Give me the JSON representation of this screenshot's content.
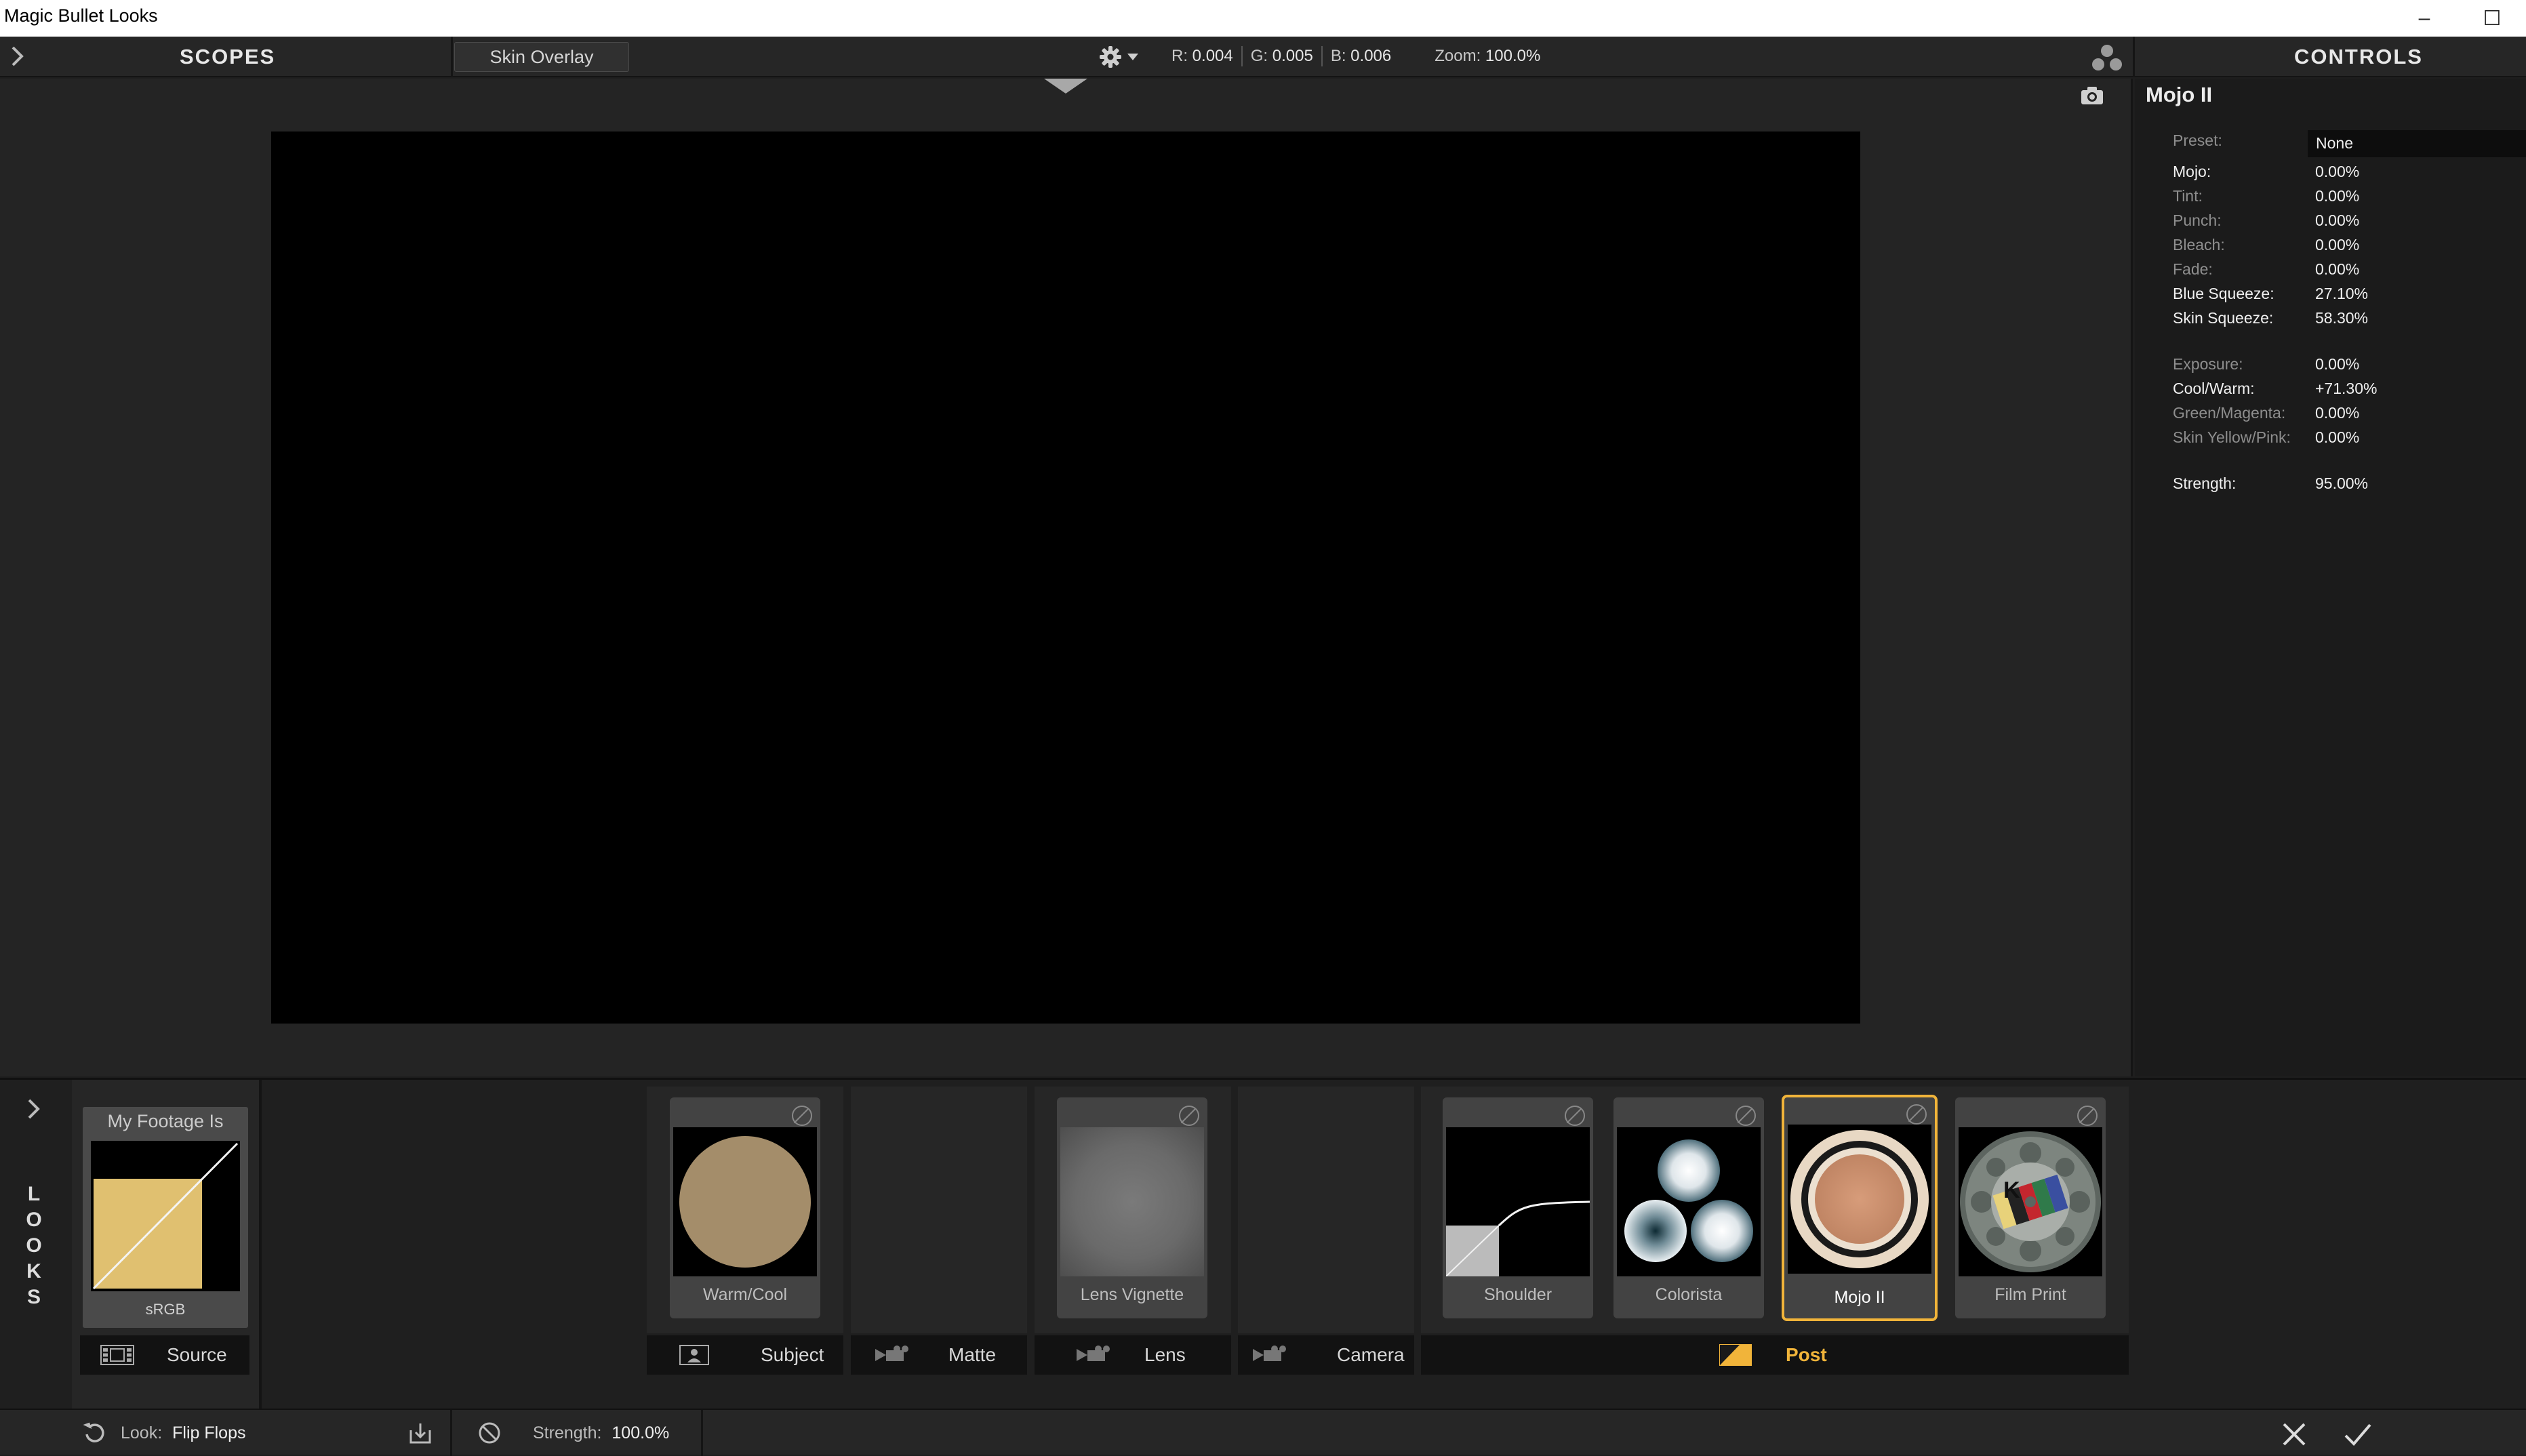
{
  "window": {
    "title": "Magic Bullet Looks",
    "minimize": "–",
    "maximize": "☐"
  },
  "topbar": {
    "scopes_label": "SCOPES",
    "skin_overlay_label": "Skin Overlay",
    "r_label": "R:",
    "r_value": "0.004",
    "g_label": "G:",
    "g_value": "0.005",
    "b_label": "B:",
    "b_value": "0.006",
    "zoom_label": "Zoom:",
    "zoom_value": "100.0%",
    "controls_label": "CONTROLS"
  },
  "controls": {
    "tool_name": "Mojo II",
    "preset_label": "Preset:",
    "preset_value": "None",
    "params": [
      {
        "label": "Mojo:",
        "value": "0.00%"
      },
      {
        "label": "Tint:",
        "value": "0.00%"
      },
      {
        "label": "Punch:",
        "value": "0.00%"
      },
      {
        "label": "Bleach:",
        "value": "0.00%"
      },
      {
        "label": "Fade:",
        "value": "0.00%"
      },
      {
        "label": "Blue Squeeze:",
        "value": "27.10%"
      },
      {
        "label": "Skin Squeeze:",
        "value": "58.30%"
      },
      {
        "label": "Exposure:",
        "value": "0.00%"
      },
      {
        "label": "Cool/Warm:",
        "value": "+71.30%"
      },
      {
        "label": "Green/Magenta:",
        "value": "0.00%"
      },
      {
        "label": "Skin Yellow/Pink:",
        "value": "0.00%"
      },
      {
        "label": "Strength:",
        "value": "95.00%"
      }
    ]
  },
  "looks_tab": {
    "letters": [
      "L",
      "O",
      "O",
      "K",
      "S"
    ]
  },
  "source": {
    "card_title": "My Footage Is",
    "card_caption": "sRGB",
    "section_label": "Source"
  },
  "tools": {
    "warm_cool": "Warm/Cool",
    "lens_vignette": "Lens Vignette",
    "shoulder": "Shoulder",
    "colorista": "Colorista",
    "mojo": "Mojo II",
    "film_print": "Film Print",
    "film_print_letter": "K"
  },
  "sections": {
    "subject": "Subject",
    "matte": "Matte",
    "lens": "Lens",
    "camera": "Camera",
    "post": "Post"
  },
  "status": {
    "look_label": "Look:",
    "look_value": "Flip Flops",
    "strength_label": "Strength:",
    "strength_value": "100.0%"
  },
  "colors": {
    "accent": "#f1b43a",
    "source_fill": "#e0c070",
    "warm_cool_fill": "#a48d6a"
  }
}
